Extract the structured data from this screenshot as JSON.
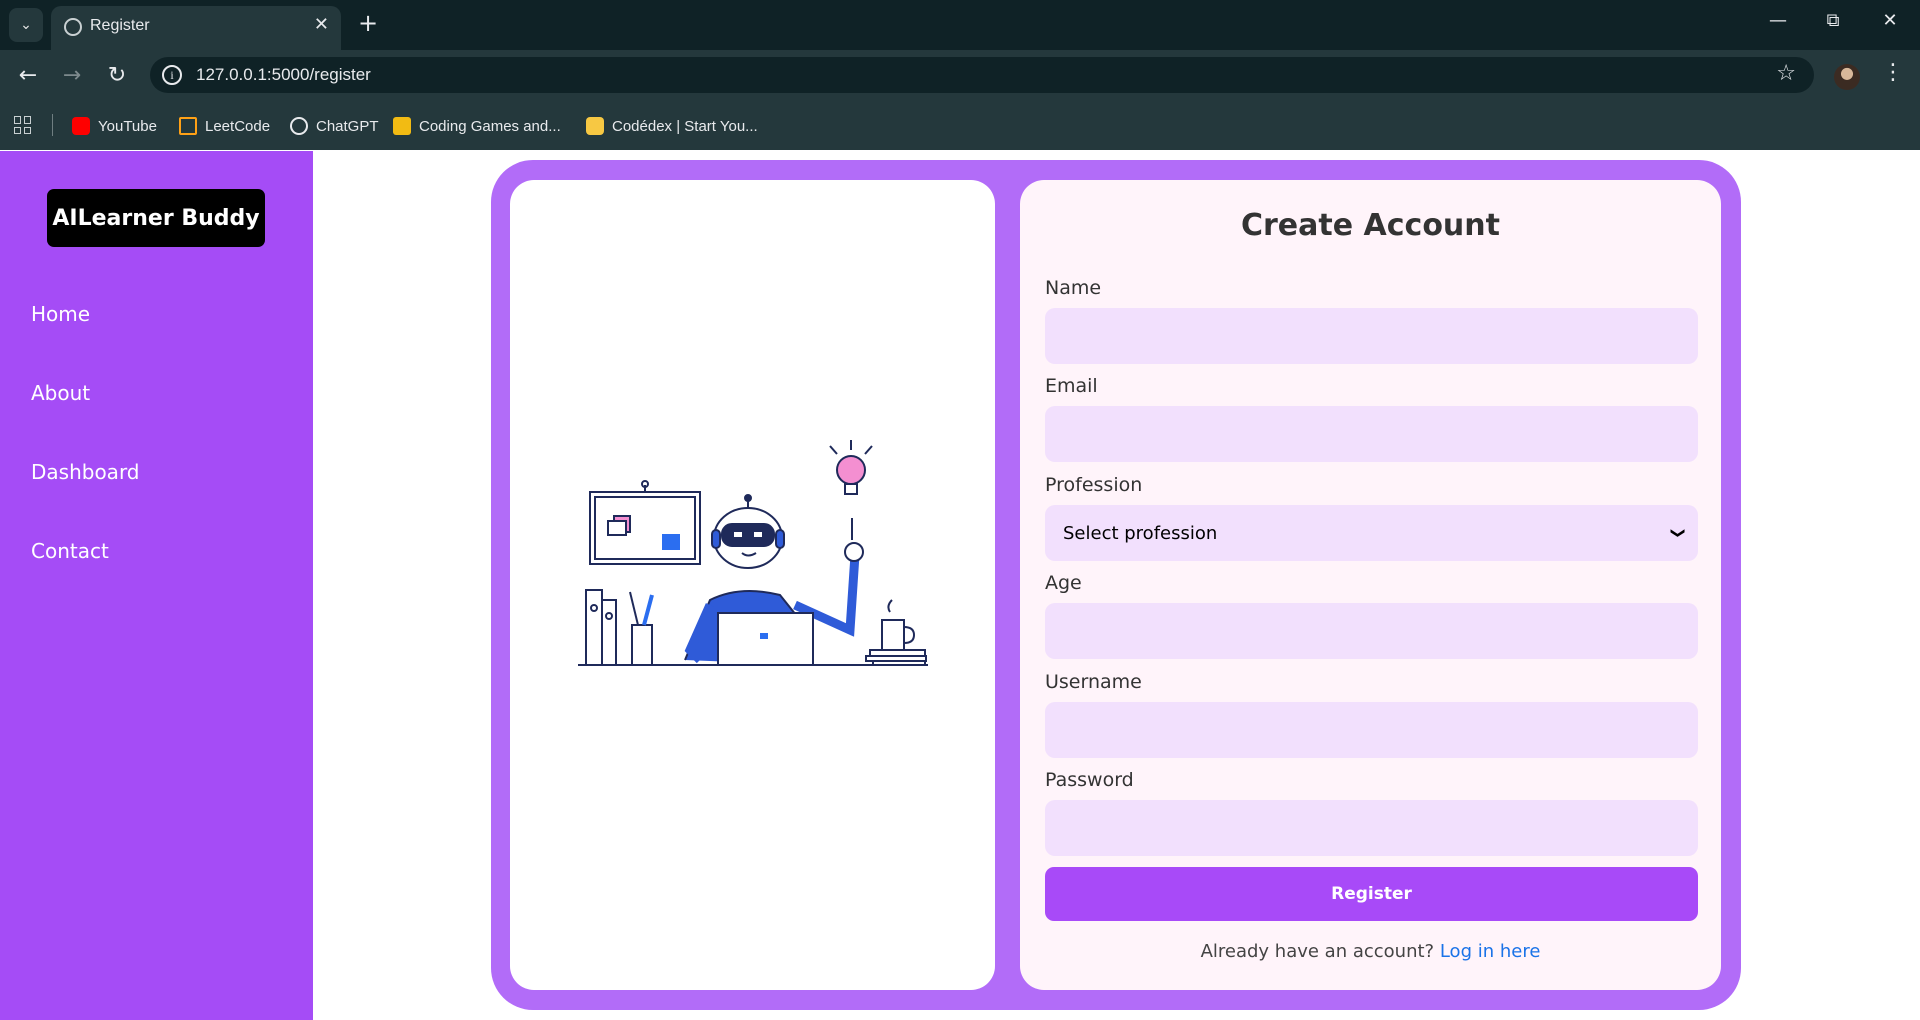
{
  "browser": {
    "tab_title": "Register",
    "url": "127.0.0.1:5000/register",
    "bookmarks": [
      {
        "label": "YouTube",
        "icon": "youtube-icon",
        "color": "#ff0000"
      },
      {
        "label": "LeetCode",
        "icon": "leetcode-icon",
        "color": "#ffa116"
      },
      {
        "label": "ChatGPT",
        "icon": "chatgpt-icon",
        "color": "#e8eaed"
      },
      {
        "label": "Coding Games and...",
        "icon": "codingame-icon",
        "color": "#f2bb13"
      },
      {
        "label": "Codédex | Start You...",
        "icon": "codedex-icon",
        "color": "#f7c843"
      }
    ]
  },
  "sidebar": {
    "brand": "AILearner Buddy",
    "items": [
      {
        "label": "Home"
      },
      {
        "label": "About"
      },
      {
        "label": "Dashboard"
      },
      {
        "label": "Contact"
      }
    ]
  },
  "form": {
    "title": "Create Account",
    "fields": [
      {
        "label": "Name",
        "value": ""
      },
      {
        "label": "Email",
        "value": ""
      },
      {
        "label": "Profession",
        "value": "Select profession"
      },
      {
        "label": "Age",
        "value": ""
      },
      {
        "label": "Username",
        "value": ""
      },
      {
        "label": "Password",
        "value": ""
      }
    ],
    "submit_label": "Register",
    "login_prompt": "Already have an account?",
    "login_link": "Log in here"
  },
  "colors": {
    "sidebar": "#a54cf6",
    "frame": "#b26cf8",
    "button": "#a84af8",
    "input": "#f2e0fd",
    "link": "#1a73e8"
  },
  "illustration": "robot-at-laptop-illustration"
}
